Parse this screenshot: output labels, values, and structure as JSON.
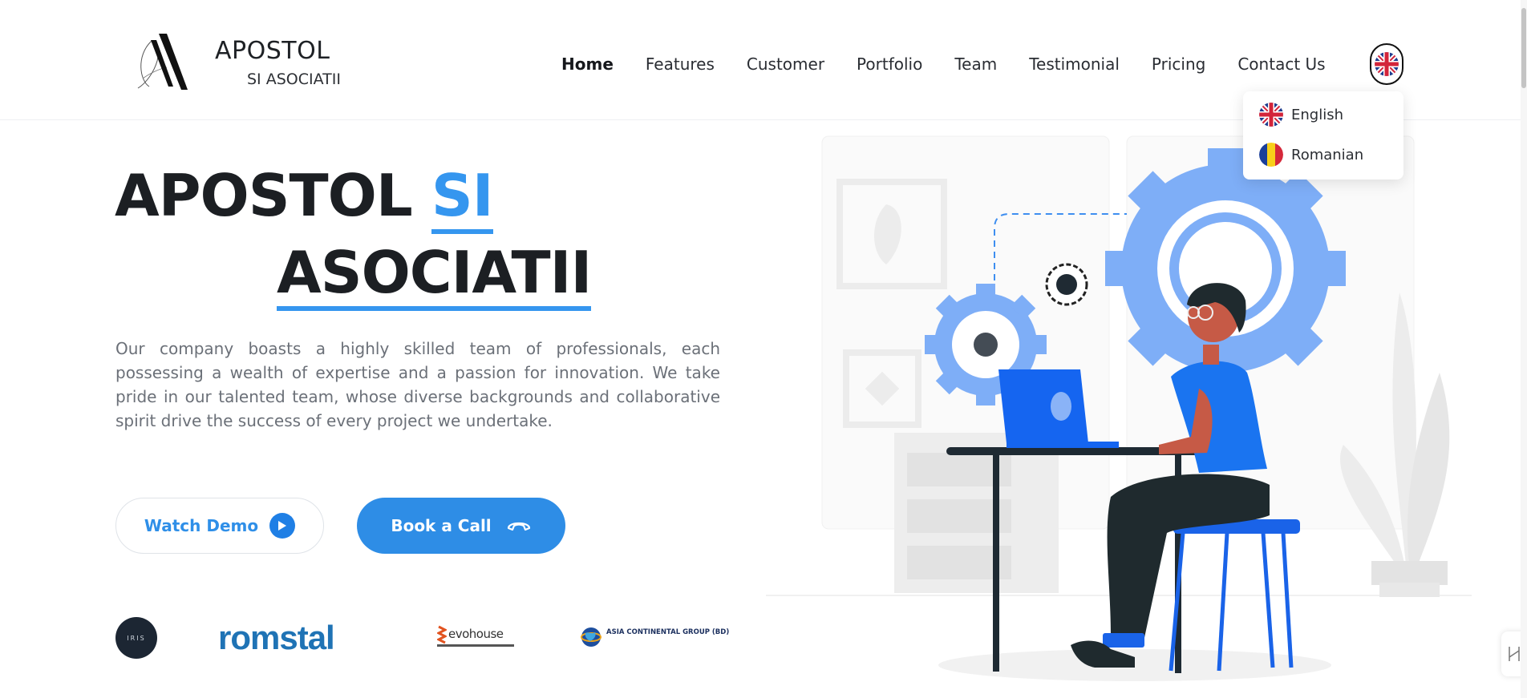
{
  "brand": {
    "name": "APOSTOL",
    "subtitle": "SI ASOCIATII"
  },
  "nav": {
    "items": [
      {
        "label": "Home",
        "active": true
      },
      {
        "label": "Features"
      },
      {
        "label": "Customer"
      },
      {
        "label": "Portfolio"
      },
      {
        "label": "Team"
      },
      {
        "label": "Testimonial"
      },
      {
        "label": "Pricing"
      },
      {
        "label": "Contact Us"
      }
    ]
  },
  "language": {
    "current_icon": "uk-flag-icon",
    "options": [
      {
        "label": "English",
        "icon": "uk-flag-icon"
      },
      {
        "label": "Romanian",
        "icon": "romania-flag-icon"
      }
    ]
  },
  "hero": {
    "title_part1": "APOSTOL",
    "title_part2": "SI",
    "title_part3": "ASOCIATII",
    "description": "Our company boasts a highly skilled team of professionals, each possessing a wealth of expertise and a passion for innovation. We take pride in our talented team, whose diverse backgrounds and collaborative spirit drive the success of every project we undertake.",
    "watch_demo_label": "Watch Demo",
    "book_call_label": "Book a Call"
  },
  "clients": [
    {
      "name": "IRIS",
      "icon": "iris-logo"
    },
    {
      "name": "romstal",
      "icon": "romstal-logo"
    },
    {
      "name": "evohouse",
      "icon": "evohouse-logo"
    },
    {
      "name": "ASIA CONTINENTAL GROUP (BD)",
      "icon": "asia-continental-logo"
    }
  ],
  "colors": {
    "accent": "#3596ef",
    "button_primary": "#2e8de6",
    "text_dark": "#1c1f23",
    "text_muted": "#6b7078",
    "illustration_blue": "#7eaef7",
    "laptop_blue": "#1565f0"
  }
}
